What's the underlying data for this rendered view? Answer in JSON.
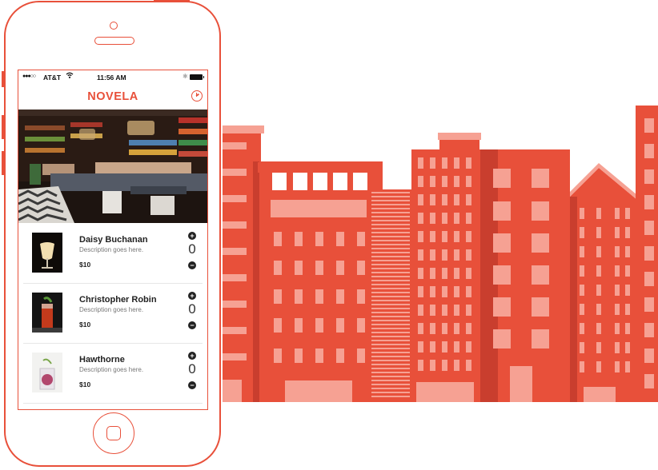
{
  "colors": {
    "accent": "#e8503a",
    "building_light": "#f6a193",
    "building_dark": "#c93e2e"
  },
  "status_bar": {
    "signal": "●●●○○",
    "carrier": "AT&T",
    "time": "11:56 AM"
  },
  "app": {
    "title": "NOVELA",
    "order_icon": "clock-icon"
  },
  "hero": {
    "image": "bar-interior-photo"
  },
  "menu_items": [
    {
      "name": "Daisy Buchanan",
      "description": "Description goes here.",
      "price": "$10",
      "quantity": "0",
      "image": "cocktail-daisy"
    },
    {
      "name": "Christopher Robin",
      "description": "Description goes here.",
      "price": "$10",
      "quantity": "0",
      "image": "cocktail-christopher"
    },
    {
      "name": "Hawthorne",
      "description": "Description goes here.",
      "price": "$10",
      "quantity": "0",
      "image": "cocktail-hawthorne"
    }
  ]
}
